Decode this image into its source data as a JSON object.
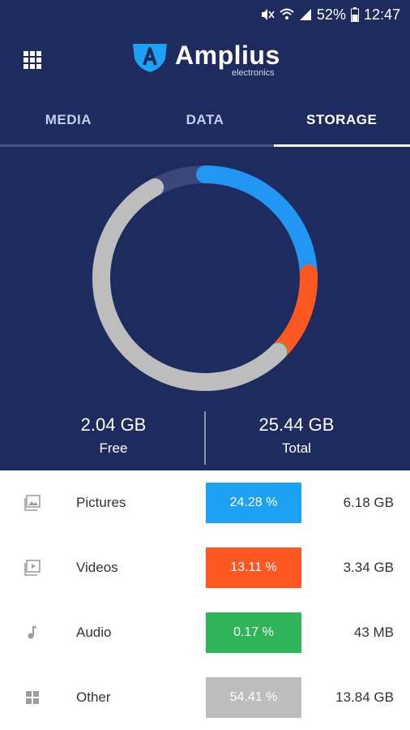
{
  "status_bar": {
    "battery": "52%",
    "time": "12:47"
  },
  "header": {
    "logo_text": "Amplius",
    "logo_sub": "electronics"
  },
  "tabs": [
    {
      "label": "MEDIA",
      "active": false
    },
    {
      "label": "DATA",
      "active": false
    },
    {
      "label": "STORAGE",
      "active": true
    }
  ],
  "storage": {
    "free": {
      "value": "2.04 GB",
      "label": "Free"
    },
    "total": {
      "value": "25.44 GB",
      "label": "Total"
    }
  },
  "chart_data": {
    "type": "pie",
    "series": [
      {
        "label": "Pictures",
        "value": 24.28,
        "color": "#2196f3"
      },
      {
        "label": "Videos",
        "value": 13.11,
        "color": "#ff5722"
      },
      {
        "label": "Audio",
        "value": 0.17,
        "color": "#4caf50"
      },
      {
        "label": "Other",
        "value": 54.41,
        "color": "#bdbdbd"
      },
      {
        "label": "Free",
        "value": 8.02,
        "color": "#3a477a"
      }
    ]
  },
  "categories": [
    {
      "name": "Pictures",
      "percent": "24.28 %",
      "size": "6.18 GB",
      "color": "#1da1f2",
      "icon": "image-icon"
    },
    {
      "name": "Videos",
      "percent": "13.11 %",
      "size": "3.34 GB",
      "color": "#ff5722",
      "icon": "video-icon"
    },
    {
      "name": "Audio",
      "percent": "0.17 %",
      "size": "43 MB",
      "color": "#2eb55a",
      "icon": "music-note-icon"
    },
    {
      "name": "Other",
      "percent": "54.41 %",
      "size": "13.84 GB",
      "color": "#bdbdbd",
      "icon": "apps-icon"
    }
  ]
}
